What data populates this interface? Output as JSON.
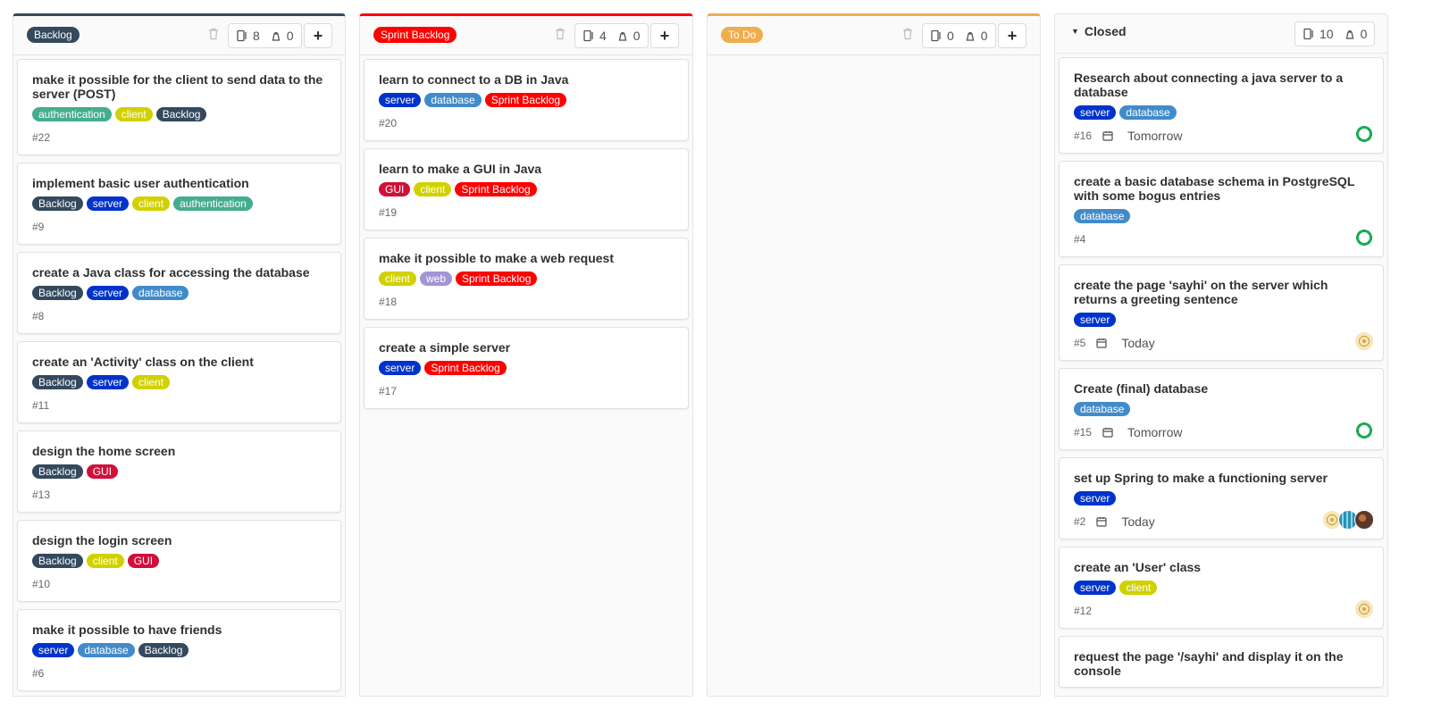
{
  "colors": {
    "Backlog": "#34495e",
    "Sprint Backlog": "#ff0000",
    "To Do": "#f0ad4e",
    "authentication": "#44ad8e",
    "client": "#d1d100",
    "server": "#0033cc",
    "database": "#428bca",
    "GUI": "#d10f3a",
    "web": "#a295d6"
  },
  "columns": [
    {
      "title": "Backlog",
      "issue_count": "8",
      "weight": "0",
      "cards": [
        {
          "title": "make it possible for the client to send data to the server (POST)",
          "labels": [
            "authentication",
            "client",
            "Backlog"
          ],
          "ref": "#22"
        },
        {
          "title": "implement basic user authentication",
          "labels": [
            "Backlog",
            "server",
            "client",
            "authentication"
          ],
          "ref": "#9"
        },
        {
          "title": "create a Java class for accessing the database",
          "labels": [
            "Backlog",
            "server",
            "database"
          ],
          "ref": "#8"
        },
        {
          "title": "create an 'Activity' class on the client",
          "labels": [
            "Backlog",
            "server",
            "client"
          ],
          "ref": "#11"
        },
        {
          "title": "design the home screen",
          "labels": [
            "Backlog",
            "GUI"
          ],
          "ref": "#13"
        },
        {
          "title": "design the login screen",
          "labels": [
            "Backlog",
            "client",
            "GUI"
          ],
          "ref": "#10"
        },
        {
          "title": "make it possible to have friends",
          "labels": [
            "server",
            "database",
            "Backlog"
          ],
          "ref": "#6"
        }
      ]
    },
    {
      "title": "Sprint Backlog",
      "issue_count": "4",
      "weight": "0",
      "cards": [
        {
          "title": "learn to connect to a DB in Java",
          "labels": [
            "server",
            "database",
            "Sprint Backlog"
          ],
          "ref": "#20"
        },
        {
          "title": "learn to make a GUI in Java",
          "labels": [
            "GUI",
            "client",
            "Sprint Backlog"
          ],
          "ref": "#19"
        },
        {
          "title": "make it possible to make a web request",
          "labels": [
            "client",
            "web",
            "Sprint Backlog"
          ],
          "ref": "#18"
        },
        {
          "title": "create a simple server",
          "labels": [
            "server",
            "Sprint Backlog"
          ],
          "ref": "#17"
        }
      ]
    },
    {
      "title": "To Do",
      "issue_count": "0",
      "weight": "0",
      "cards": []
    },
    {
      "title": "Closed",
      "issue_count": "10",
      "weight": "0",
      "cards": [
        {
          "title": "Research about connecting a java server to a database",
          "labels": [
            "server",
            "database"
          ],
          "ref": "#16",
          "due": "Tomorrow",
          "avatars": [
            "green-ring"
          ]
        },
        {
          "title": "create a basic database schema in PostgreSQL with some bogus entries",
          "labels": [
            "database"
          ],
          "ref": "#4",
          "avatars": [
            "green-ring"
          ]
        },
        {
          "title": "create the page 'sayhi' on the server which returns a greeting sentence",
          "labels": [
            "server"
          ],
          "ref": "#5",
          "due": "Today",
          "avatars": [
            "gold-dots"
          ]
        },
        {
          "title": "Create (final) database",
          "labels": [
            "database"
          ],
          "ref": "#15",
          "due": "Tomorrow",
          "avatars": [
            "green-ring"
          ]
        },
        {
          "title": "set up Spring to make a functioning server",
          "labels": [
            "server"
          ],
          "ref": "#2",
          "due": "Today",
          "avatars": [
            "gold-dots",
            "teal-grid",
            "photo"
          ]
        },
        {
          "title": "create an 'User' class",
          "labels": [
            "server",
            "client"
          ],
          "ref": "#12",
          "avatars": [
            "gold-dots"
          ]
        },
        {
          "title": "request the page '/sayhi' and display it on the console",
          "labels": [],
          "ref": ""
        }
      ]
    }
  ]
}
